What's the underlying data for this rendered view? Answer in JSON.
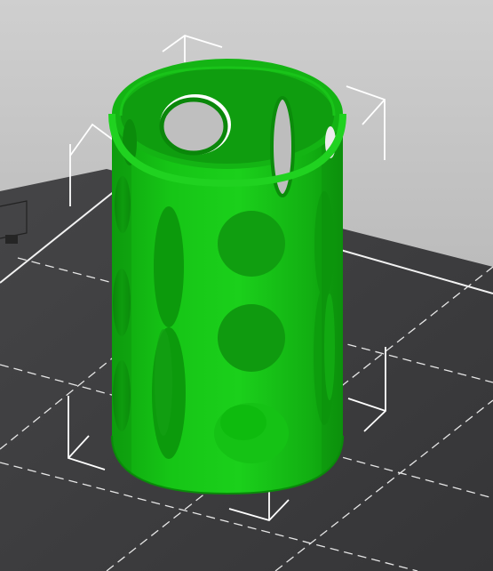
{
  "scene": {
    "background_top_color": "#c8c8c8",
    "background_bottom_color": "#a8a8a8",
    "bed_color": "#3f3f41",
    "bed_grid_color": "#e6e6e6",
    "bed_edge_color": "#f2f2f2",
    "model_color": "#11b811",
    "model_highlight_color": "#1ed81e",
    "model_shadow_color": "#0b8f0b",
    "bounding_box_color": "#ffffff"
  },
  "model": {
    "shape": "cylinder",
    "style": "perforated vase with oval holes",
    "selected": true
  }
}
